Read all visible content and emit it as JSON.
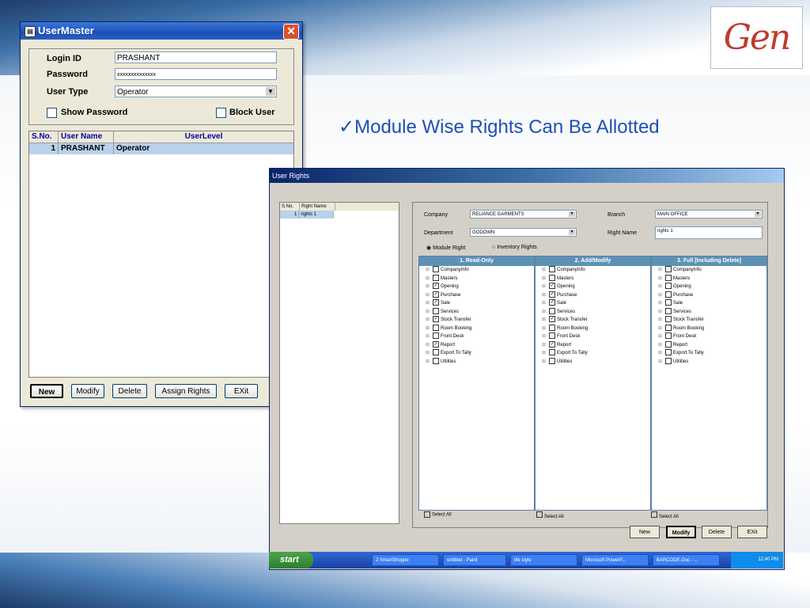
{
  "logo": {
    "text": "Gen"
  },
  "headline": "✓Module Wise Rights Can Be Allotted",
  "usermaster": {
    "title": "UserMaster",
    "login_label": "Login ID",
    "login_value": "PRASHANT",
    "password_label": "Password",
    "password_value": "xxxxxxxxxxxxxx",
    "usertype_label": "User Type",
    "usertype_value": "Operator",
    "show_password": "Show Password",
    "block_user": "Block User",
    "columns": [
      "S.No.",
      "User Name",
      "UserLevel"
    ],
    "rows": [
      {
        "sno": "1",
        "name": "PRASHANT",
        "level": "Operator"
      }
    ],
    "buttons": [
      "New",
      "Modify",
      "Delete",
      "Assign Rights",
      "EXit"
    ]
  },
  "userrights": {
    "title": "User Rights",
    "list_columns": [
      "S.No.",
      "Right Name"
    ],
    "list_rows": [
      {
        "sno": "1",
        "name": "rights 1"
      }
    ],
    "company_label": "Company",
    "company_value": "RELIANCE GARMENTS",
    "branch_label": "Branch",
    "branch_value": "MAIN OFFICE",
    "department_label": "Department",
    "department_value": "GODOWN",
    "rightname_label": "Right Name",
    "rightname_value": "rights 1",
    "radio_module": "Module Right",
    "radio_inventory": "Inventory Rights",
    "col1_title": "1. Read-Only",
    "col2_title": "2. Add/Modify",
    "col3_title": "3. Full [Including Delete]",
    "modules": [
      "CompanyInfo",
      "Masters",
      "Opening",
      "Purchase",
      "Sale",
      "Services",
      "Stock Transfer",
      "Room Booking",
      "Front Desk",
      "Report",
      "Export To Tally",
      "Utilities"
    ],
    "col1_checked": [
      false,
      false,
      true,
      true,
      true,
      false,
      true,
      false,
      false,
      true,
      false,
      false
    ],
    "col2_checked": [
      false,
      false,
      true,
      true,
      true,
      false,
      true,
      false,
      false,
      true,
      false,
      false
    ],
    "col3_checked": [
      false,
      false,
      false,
      false,
      false,
      false,
      false,
      false,
      false,
      false,
      false,
      false
    ],
    "select_all": "Select All",
    "buttons": [
      "New",
      "Modify",
      "Delete",
      "EXit"
    ]
  },
  "taskbar": {
    "start": "start",
    "items": [
      "2 SmartShoppe",
      "untitled - Paint",
      "life style",
      "Microsoft PowerP...",
      "BARCODE.Doc - ..."
    ],
    "clock": "12:40 PM"
  }
}
